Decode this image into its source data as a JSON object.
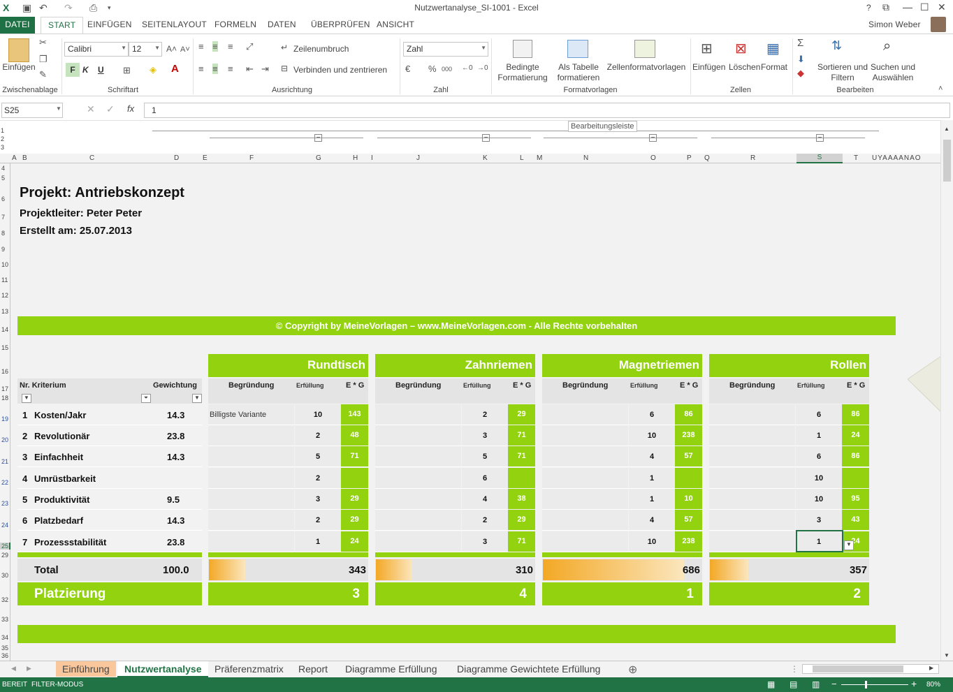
{
  "window": {
    "title": "Nutzwertanalyse_SI-1001 - Excel",
    "user": "Simon Weber",
    "help": "?"
  },
  "tabs": [
    "DATEI",
    "START",
    "EINFÜGEN",
    "SEITENLAYOUT",
    "FORMELN",
    "DATEN",
    "ÜBERPRÜFEN",
    "ANSICHT"
  ],
  "ribbon": {
    "clipboard": {
      "paste": "Einfügen",
      "group": "Zwischenablage"
    },
    "font": {
      "name": "Calibri",
      "size": "12",
      "bold": "F",
      "italic": "K",
      "underline": "U",
      "group": "Schriftart"
    },
    "align": {
      "wrap": "Zeilenumbruch",
      "merge": "Verbinden und zentrieren",
      "group": "Ausrichtung"
    },
    "number": {
      "format": "Zahl",
      "percent": "%",
      "thousand": "000",
      "group": "Zahl"
    },
    "styles": {
      "cond1": "Bedingte",
      "cond2": "Formatierung",
      "table1": "Als Tabelle",
      "table2": "formatieren",
      "cellstyles": "Zellenformatvorlagen",
      "group": "Formatvorlagen"
    },
    "cells": {
      "insert": "Einfügen",
      "delete": "Löschen",
      "format": "Format",
      "group": "Zellen"
    },
    "edit": {
      "sort1": "Sortieren und",
      "sort2": "Filtern",
      "find1": "Suchen und",
      "find2": "Auswählen",
      "group": "Bearbeiten"
    }
  },
  "formula": {
    "namebox": "S25",
    "fx": "fx",
    "value": "1",
    "tooltip": "Bearbeitungsleiste"
  },
  "outline_levels": [
    "1",
    "2",
    "3"
  ],
  "columns": [
    "A",
    "B",
    "C",
    "D",
    "E",
    "F",
    "G",
    "H",
    "I",
    "J",
    "K",
    "L",
    "M",
    "N",
    "O",
    "P",
    "Q",
    "R",
    "S",
    "T",
    "U",
    "Y",
    "A",
    "A",
    "A",
    "A",
    "N",
    "A",
    "O"
  ],
  "rows": [
    "4",
    "5",
    "6",
    "7",
    "8",
    "9",
    "10",
    "11",
    "12",
    "13",
    "14",
    "15",
    "16",
    "17",
    "18",
    "19",
    "20",
    "21",
    "22",
    "23",
    "24",
    "25",
    "29",
    "30",
    "32",
    "33",
    "34",
    "35",
    "36"
  ],
  "project": {
    "title": "Projekt: Antriebskonzept",
    "leader": "Projektleiter: Peter Peter",
    "created": "Erstellt am: 25.07.2013"
  },
  "copyright": "© Copyright by MeineVorlagen – www.MeineVorlagen.com - Alle Rechte vorbehalten",
  "table_header": {
    "nr_kriterium": "Nr. Kriterium",
    "gewichtung": "Gewichtung",
    "begruendung": "Begründung",
    "erfuellung": "Erfüllung",
    "exg": "E * G"
  },
  "criteria": [
    {
      "nr": "1",
      "name": "Kosten/Jakr",
      "weight": "14.3"
    },
    {
      "nr": "2",
      "name": "Revolutionär",
      "weight": "23.8"
    },
    {
      "nr": "3",
      "name": "Einfachheit",
      "weight": "14.3"
    },
    {
      "nr": "4",
      "name": "Umrüstbarkeit",
      "weight": ""
    },
    {
      "nr": "5",
      "name": "Produktivität",
      "weight": "9.5"
    },
    {
      "nr": "6",
      "name": "Platzbedarf",
      "weight": "14.3"
    },
    {
      "nr": "7",
      "name": "Prozessstabilität",
      "weight": "23.8"
    }
  ],
  "variants": [
    {
      "name": "Rundtisch",
      "reasons": [
        "Billigste Variante",
        "",
        "",
        "",
        "",
        "",
        ""
      ],
      "fulfill": [
        "10",
        "2",
        "5",
        "2",
        "3",
        "2",
        "1"
      ],
      "exg": [
        "143",
        "48",
        "71",
        "",
        "29",
        "29",
        "24"
      ],
      "total": "343",
      "rank": "3",
      "bar": 0.45
    },
    {
      "name": "Zahnriemen",
      "reasons": [
        "",
        "",
        "",
        "",
        "",
        "",
        ""
      ],
      "fulfill": [
        "2",
        "3",
        "5",
        "6",
        "4",
        "2",
        "3"
      ],
      "exg": [
        "29",
        "71",
        "71",
        "",
        "38",
        "29",
        "71"
      ],
      "total": "310",
      "rank": "4",
      "bar": 0.45
    },
    {
      "name": "Magnetriemen",
      "reasons": [
        "",
        "",
        "",
        "",
        "",
        "",
        ""
      ],
      "fulfill": [
        "6",
        "10",
        "4",
        "1",
        "1",
        "4",
        "10"
      ],
      "exg": [
        "86",
        "238",
        "57",
        "",
        "10",
        "57",
        "238"
      ],
      "total": "686",
      "rank": "1",
      "bar": 0.88
    },
    {
      "name": "Rollen",
      "reasons": [
        "",
        "",
        "",
        "",
        "",
        "",
        ""
      ],
      "fulfill": [
        "6",
        "1",
        "6",
        "10",
        "10",
        "3",
        "1"
      ],
      "exg": [
        "86",
        "24",
        "86",
        "",
        "95",
        "43",
        "24"
      ],
      "total": "357",
      "rank": "2",
      "bar": 0.48
    }
  ],
  "total": {
    "label": "Total",
    "weight": "100.0"
  },
  "placement": "Platzierung",
  "sheet_tabs": [
    "Einführung",
    "Nutzwertanalyse",
    "Präferenzmatrix",
    "Report",
    "Diagramme Erfüllung",
    "Diagramme Gewichtete Erfüllung"
  ],
  "status": {
    "ready": "BEREIT",
    "mode": "FILTER-MODUS",
    "zoom": "80%"
  }
}
